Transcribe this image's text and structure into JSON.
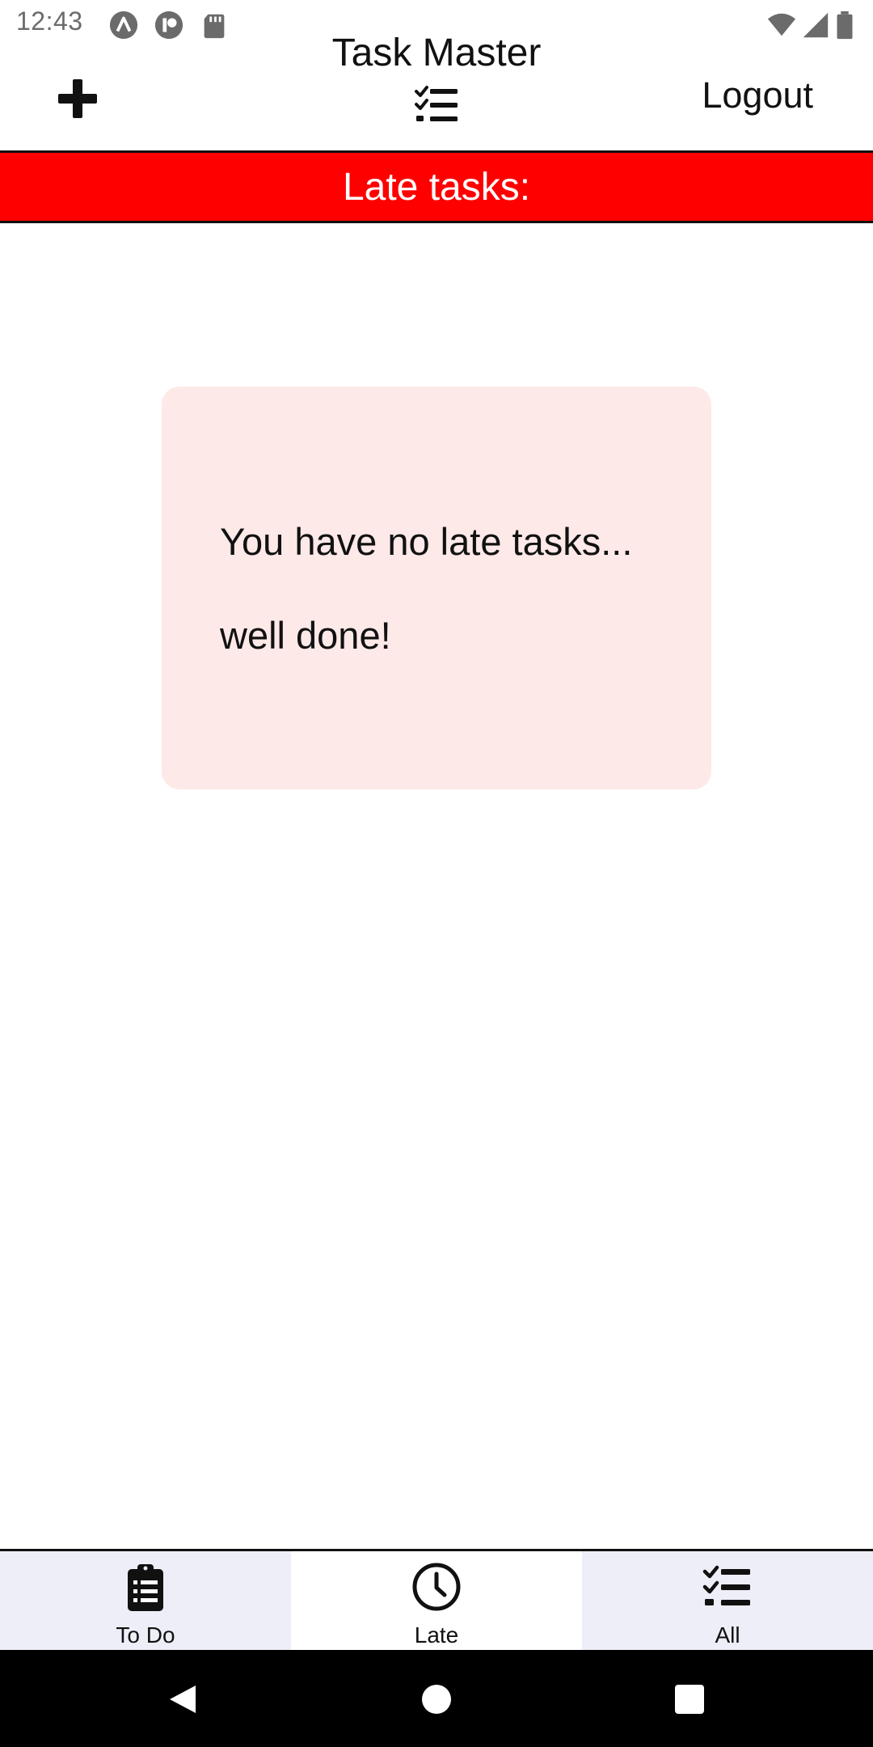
{
  "status_bar": {
    "time": "12:43",
    "left_icons": [
      "app-a-icon",
      "app-p-icon",
      "sd-card-icon"
    ],
    "right_icons": [
      "wifi-icon",
      "cell-signal-icon",
      "battery-icon"
    ]
  },
  "header": {
    "title": "Task Master",
    "add_icon": "plus-icon",
    "title_icon": "checklist-icon",
    "logout_label": "Logout"
  },
  "banner": {
    "text": "Late tasks:",
    "color": "#ff0000"
  },
  "empty_state": {
    "line1": "You have no late tasks...",
    "line2": "well done!",
    "background": "#fde9e8"
  },
  "tabs": [
    {
      "label": "To Do",
      "icon": "clipboard-list-icon",
      "active": false
    },
    {
      "label": "Late",
      "icon": "clock-icon",
      "active": true
    },
    {
      "label": "All",
      "icon": "checklist-icon",
      "active": false
    }
  ],
  "system_nav": [
    "back-icon",
    "home-icon",
    "recents-icon"
  ]
}
